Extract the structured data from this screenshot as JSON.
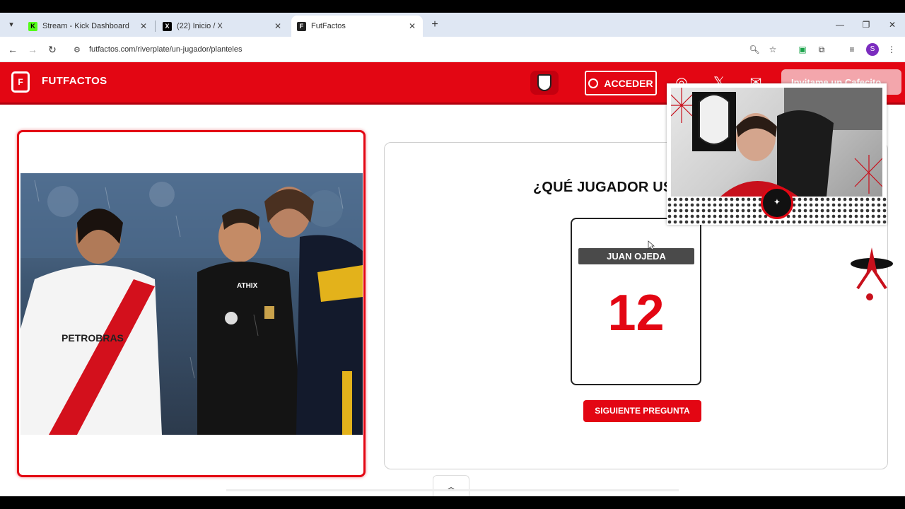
{
  "browser": {
    "tabs": [
      {
        "title": "Stream - Kick Dashboard",
        "favicon": "kick-icon",
        "color": "#53fc18"
      },
      {
        "title": "(22) Inicio / X",
        "favicon": "x-icon",
        "color": "#000000"
      },
      {
        "title": "FutFactos",
        "favicon": "futfactos-icon",
        "color": "#222222"
      }
    ],
    "url": "futfactos.com/riverplate/un-jugador/planteles",
    "profile_initial": "S"
  },
  "site": {
    "logo_text": "FUTFACTOS",
    "login_label": "ACCEDER",
    "cafecito_label": "Invitame un Cafecito",
    "accent_color": "#e30613"
  },
  "quiz": {
    "question": "¿QUÉ JUGADOR USÓ EL N",
    "answer_name": "JUAN OJEDA",
    "answer_number": "12",
    "next_label": "SIGUIENTE PREGUNTA (ENTER)"
  },
  "photo": {
    "jersey_text": "PETROBRAS",
    "referee_text": "ATHIX"
  },
  "icons": [
    "tab-list-icon",
    "close-icon",
    "new-tab-icon",
    "minimize-icon",
    "restore-icon",
    "back-icon",
    "forward-icon",
    "reload-icon",
    "site-settings-icon",
    "zoom-icon",
    "bookmark-star-icon",
    "extension-icon",
    "puzzle-icon",
    "media-icon",
    "menu-icon",
    "user-icon",
    "instagram-icon",
    "x-icon",
    "mail-icon",
    "chevron-up-icon"
  ]
}
